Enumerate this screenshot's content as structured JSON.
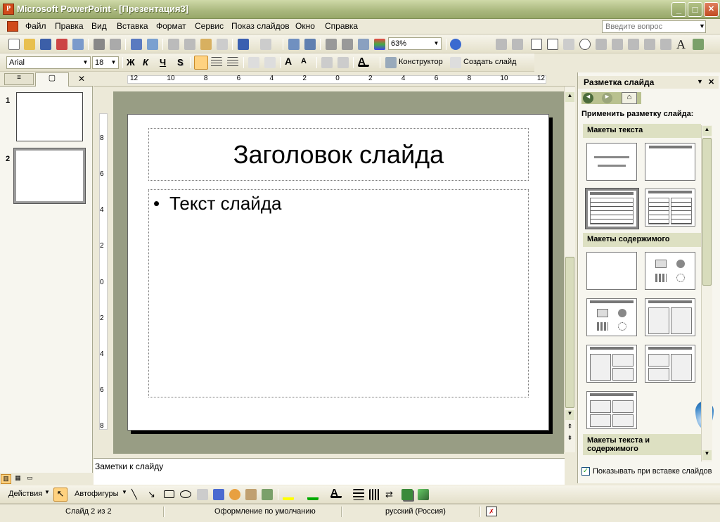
{
  "window": {
    "title": "Microsoft PowerPoint - [Презентация3]",
    "app_icon": "powerpoint-icon",
    "minimize": "_",
    "maximize": "□",
    "close": "✕"
  },
  "menu": {
    "items": [
      {
        "label": "Файл"
      },
      {
        "label": "Правка"
      },
      {
        "label": "Вид"
      },
      {
        "label": "Вставка"
      },
      {
        "label": "Формат"
      },
      {
        "label": "Сервис"
      },
      {
        "label": "Показ слайдов"
      },
      {
        "label": "Окно"
      },
      {
        "label": "Справка"
      }
    ],
    "ask_placeholder": "Введите вопрос"
  },
  "standard_toolbar": {
    "zoom": "63%"
  },
  "format_toolbar": {
    "font": "Arial",
    "size": "18",
    "bold": "Ж",
    "italic": "К",
    "underline": "Ч",
    "shadow": "S",
    "designer": "Конструктор",
    "new_slide": "Создать слайд"
  },
  "slides_pane": {
    "thumbs": [
      {
        "num": "1"
      },
      {
        "num": "2"
      }
    ],
    "close": "✕"
  },
  "ruler": {
    "h_labels": [
      "12",
      "10",
      "8",
      "6",
      "4",
      "2",
      "0",
      "2",
      "4",
      "6",
      "8",
      "10",
      "12"
    ],
    "v_labels": [
      "8",
      "6",
      "4",
      "2",
      "0",
      "2",
      "4",
      "6",
      "8"
    ]
  },
  "slide": {
    "title": "Заголовок слайда",
    "bullet": "•",
    "body": "Текст слайда"
  },
  "notes": {
    "placeholder": "Заметки к слайду"
  },
  "task_pane": {
    "title": "Разметка слайда",
    "close": "✕",
    "apply_label": "Применить разметку слайда:",
    "sections": [
      "Макеты текста",
      "Макеты содержимого",
      "Макеты текста и содержимого"
    ],
    "show_on_insert": "Показывать при вставке слайдов"
  },
  "drawing_toolbar": {
    "actions": "Действия",
    "autoshapes": "Автофигуры"
  },
  "status": {
    "slide": "Слайд 2 из 2",
    "design": "Оформление по умолчанию",
    "language": "русский (Россия)"
  }
}
